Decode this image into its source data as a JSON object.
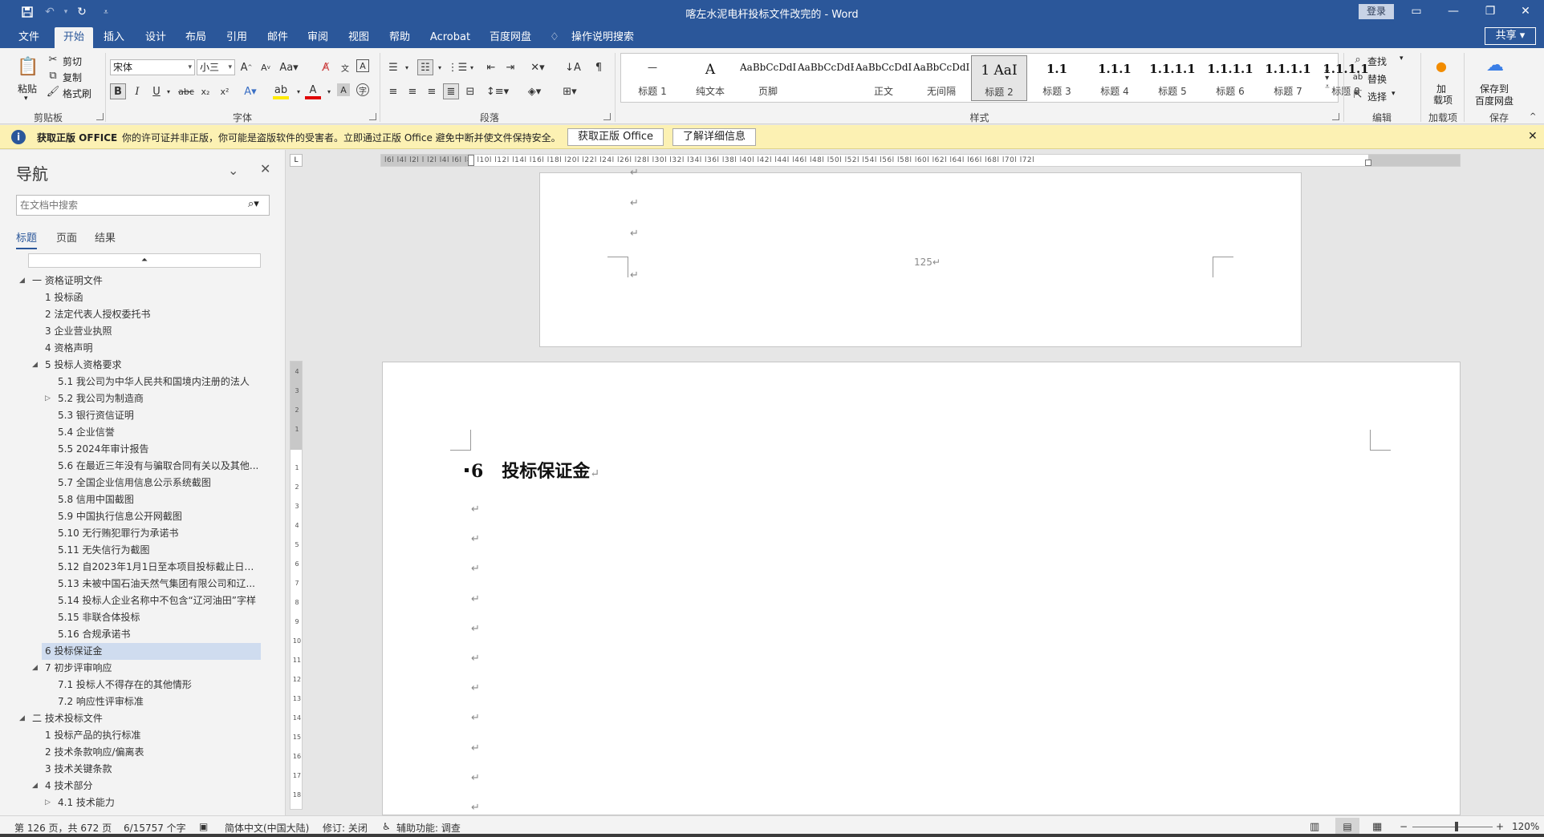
{
  "window": {
    "title": "喀左水泥电杆投标文件改完的 - Word",
    "login": "登录",
    "share": "共享"
  },
  "tabs": [
    "文件",
    "开始",
    "插入",
    "设计",
    "布局",
    "引用",
    "邮件",
    "审阅",
    "视图",
    "帮助",
    "Acrobat",
    "百度网盘"
  ],
  "active_tab": "开始",
  "tell_me": "操作说明搜索",
  "clipboard": {
    "paste": "粘贴",
    "cut": "剪切",
    "copy": "复制",
    "format_painter": "格式刷",
    "group": "剪贴板"
  },
  "font": {
    "name": "宋体",
    "size": "小三",
    "group": "字体"
  },
  "paragraph": {
    "group": "段落"
  },
  "styles": {
    "group": "样式",
    "items": [
      {
        "preview": "—",
        "name": "标题 1"
      },
      {
        "preview": "A",
        "name": "纯文本"
      },
      {
        "preview": "AaBbCcDdI",
        "name": "页脚"
      },
      {
        "preview": "AaBbCcDdEe",
        "name": ""
      },
      {
        "preview": "AaBbCcDdI",
        "name": "正文"
      },
      {
        "preview": "AaBbCcDdI",
        "name": "无间隔"
      },
      {
        "preview": "1  AaI",
        "name": "标题 2"
      },
      {
        "preview": "1.1",
        "name": "标题 3"
      },
      {
        "preview": "1.1.1",
        "name": "标题 4"
      },
      {
        "preview": "1.1.1.1",
        "name": "标题 5"
      },
      {
        "preview": "1.1.1.1",
        "name": "标题 6"
      },
      {
        "preview": "1.1.1.1",
        "name": "标题 7"
      },
      {
        "preview": "1.1.1.1",
        "name": "标题 8"
      }
    ],
    "selected": "标题 2"
  },
  "editing": {
    "find": "查找",
    "replace": "替换",
    "select": "选择",
    "group": "编辑"
  },
  "addins": {
    "label1": "加",
    "label2": "载项",
    "group": "加载项"
  },
  "baidu": {
    "line1": "保存到",
    "line2": "百度网盘",
    "group": "保存"
  },
  "infobar": {
    "title": "获取正版 OFFICE",
    "message": "你的许可证并非正版，你可能是盗版软件的受害者。立即通过正版 Office 避免中断并使文件保持安全。",
    "btn_get": "获取正版 Office",
    "btn_learn": "了解详细信息"
  },
  "nav": {
    "title": "导航",
    "search_placeholder": "在文档中搜索",
    "tabs": [
      "标题",
      "页面",
      "结果"
    ],
    "items": [
      {
        "text": "一 资格证明文件",
        "level": 0,
        "expander": "expanded"
      },
      {
        "text": "1 投标函",
        "level": 1,
        "expander": "none"
      },
      {
        "text": "2 法定代表人授权委托书",
        "level": 1,
        "expander": "none"
      },
      {
        "text": "3 企业营业执照",
        "level": 1,
        "expander": "none"
      },
      {
        "text": "4 资格声明",
        "level": 1,
        "expander": "none"
      },
      {
        "text": "5 投标人资格要求",
        "level": 1,
        "expander": "expanded"
      },
      {
        "text": "5.1 我公司为中华人民共和国境内注册的法人",
        "level": 2,
        "expander": "none"
      },
      {
        "text": "5.2 我公司为制造商",
        "level": 2,
        "expander": "collapsed"
      },
      {
        "text": "5.3 银行资信证明",
        "level": 2,
        "expander": "none"
      },
      {
        "text": "5.4 企业信誉",
        "level": 2,
        "expander": "none"
      },
      {
        "text": "5.5 2024年审计报告",
        "level": 2,
        "expander": "none"
      },
      {
        "text": "5.6 在最近三年没有与骗取合同有关以及其他...",
        "level": 2,
        "expander": "none"
      },
      {
        "text": "5.7 全国企业信用信息公示系统截图",
        "level": 2,
        "expander": "none"
      },
      {
        "text": "5.8 信用中国截图",
        "level": 2,
        "expander": "none"
      },
      {
        "text": "5.9 中国执行信息公开网截图",
        "level": 2,
        "expander": "none"
      },
      {
        "text": "5.10 无行贿犯罪行为承诺书",
        "level": 2,
        "expander": "none"
      },
      {
        "text": "5.11 无失信行为截图",
        "level": 2,
        "expander": "none"
      },
      {
        "text": "5.12 自2023年1月1日至本项目投标截止日期...",
        "level": 2,
        "expander": "none"
      },
      {
        "text": "5.13 未被中国石油天然气集团有限公司和辽...",
        "level": 2,
        "expander": "none"
      },
      {
        "text": "5.14 投标人企业名称中不包含“辽河油田”字样",
        "level": 2,
        "expander": "none"
      },
      {
        "text": "5.15 非联合体投标",
        "level": 2,
        "expander": "none"
      },
      {
        "text": "5.16 合规承诺书",
        "level": 2,
        "expander": "none"
      },
      {
        "text": "6 投标保证金",
        "level": 1,
        "expander": "none",
        "selected": true
      },
      {
        "text": "7 初步评审响应",
        "level": 1,
        "expander": "expanded"
      },
      {
        "text": "7.1 投标人不得存在的其他情形",
        "level": 2,
        "expander": "none"
      },
      {
        "text": "7.2 响应性评审标准",
        "level": 2,
        "expander": "none"
      },
      {
        "text": "二 技术投标文件",
        "level": 0,
        "expander": "expanded"
      },
      {
        "text": "1 投标产品的执行标准",
        "level": 1,
        "expander": "none"
      },
      {
        "text": "2 技术条款响应/偏离表",
        "level": 1,
        "expander": "none"
      },
      {
        "text": "3 技术关键条款",
        "level": 1,
        "expander": "none"
      },
      {
        "text": "4 技术部分",
        "level": 1,
        "expander": "expanded"
      },
      {
        "text": "4.1 技术能力",
        "level": 2,
        "expander": "collapsed"
      }
    ]
  },
  "ruler_text": "l6l  l4l  l2l   l   l2l  l4l  l6l  l8l  l10l  l12l  l14l  l16l  l18l  l20l  l22l  l24l  l26l  l28l  l30l  l32l  l34l  l36l  l38l  l40l  l42l  l44l  l46l  l48l  l50l  l52l  l54l  l56l  l58l  l60l  l62l  l64l  l66l  l68l  l70l  l72l",
  "document": {
    "page_number": "125",
    "paragraph_mark": "↵",
    "heading": "6   投标保证金"
  },
  "status": {
    "page": "第 126 页，共 672 页",
    "words": "6/15757 个字",
    "language": "简体中文(中国大陆)",
    "track": "修订: 关闭",
    "accessibility": "辅助功能: 调查",
    "zoom": "120%"
  }
}
